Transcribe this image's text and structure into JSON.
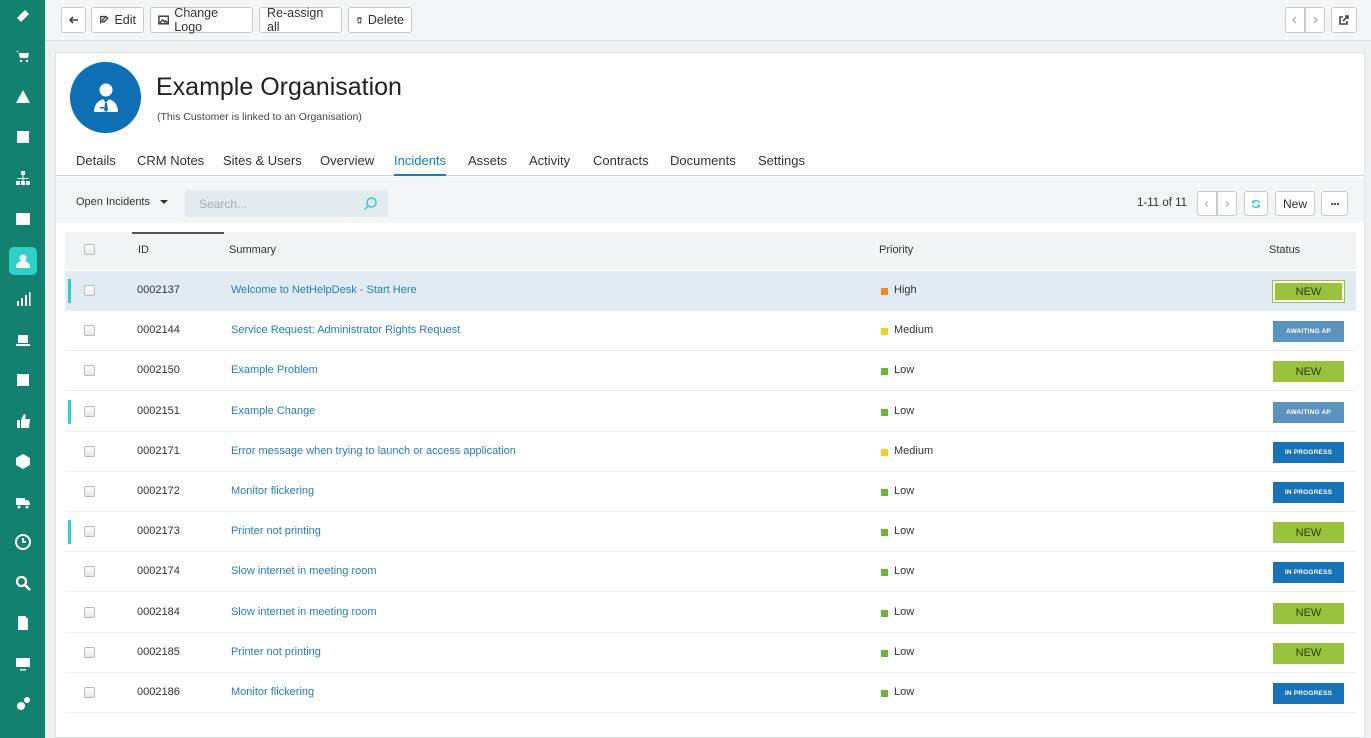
{
  "toolbar": {
    "edit_label": "Edit",
    "change_logo_label": "Change Logo",
    "reassign_label": "Re-assign all",
    "delete_label": "Delete"
  },
  "sidebar": {
    "icons": [
      "ticket-icon",
      "cart-icon",
      "warning-icon",
      "edit-icon",
      "org-chart-icon",
      "calendar-icon",
      "customer-icon",
      "analytics-icon",
      "laptop-icon",
      "notes-icon",
      "thumbs-up-icon",
      "package-icon",
      "truck-icon",
      "clock-icon",
      "search-icon",
      "document-icon",
      "monitor-icon",
      "settings-icon"
    ],
    "active_index": 6
  },
  "organisation": {
    "title": "Example Organisation",
    "subtitle": "(This Customer is linked to an Organisation)"
  },
  "tabs": [
    {
      "label": "Details"
    },
    {
      "label": "CRM Notes"
    },
    {
      "label": "Sites & Users"
    },
    {
      "label": "Overview"
    },
    {
      "label": "Incidents"
    },
    {
      "label": "Assets"
    },
    {
      "label": "Activity"
    },
    {
      "label": "Contracts"
    },
    {
      "label": "Documents"
    },
    {
      "label": "Settings"
    }
  ],
  "active_tab": "Incidents",
  "filter": {
    "selected": "Open Incidents",
    "search_placeholder": "Search...",
    "pager_text": "1-11 of 11",
    "new_label": "New"
  },
  "table": {
    "headers": {
      "id": "ID",
      "summary": "Summary",
      "priority": "Priority",
      "status": "Status"
    },
    "rows": [
      {
        "id": "0002137",
        "summary": "Welcome to NetHelpDesk - Start Here",
        "priority": "High",
        "status": "NEW"
      },
      {
        "id": "0002144",
        "summary": "Service Request: Administrator Rights Request",
        "priority": "Medium",
        "status": "AWAITING AP"
      },
      {
        "id": "0002150",
        "summary": "Example Problem",
        "priority": "Low",
        "status": "NEW"
      },
      {
        "id": "0002151",
        "summary": "Example Change",
        "priority": "Low",
        "status": "AWAITING AP"
      },
      {
        "id": "0002171",
        "summary": "Error message when trying to launch or access application",
        "priority": "Medium",
        "status": "IN PROGRESS"
      },
      {
        "id": "0002172",
        "summary": "Monitor flickering",
        "priority": "Low",
        "status": "IN PROGRESS"
      },
      {
        "id": "0002173",
        "summary": "Printer not printing",
        "priority": "Low",
        "status": "NEW"
      },
      {
        "id": "0002174",
        "summary": "Slow internet in meeting room",
        "priority": "Low",
        "status": "IN PROGRESS"
      },
      {
        "id": "0002184",
        "summary": "Slow internet in meeting room",
        "priority": "Low",
        "status": "NEW"
      },
      {
        "id": "0002185",
        "summary": "Printer not printing",
        "priority": "Low",
        "status": "NEW"
      },
      {
        "id": "0002186",
        "summary": "Monitor flickering",
        "priority": "Low",
        "status": "IN PROGRESS"
      }
    ]
  },
  "colors": {
    "sidebar": "#14806f",
    "accent": "#1a7fc1",
    "priority_high": "#f08a24",
    "priority_medium": "#f2d21f",
    "priority_low": "#6cb33e",
    "status_new": "#9ac33d",
    "status_awaiting": "#5b93c0",
    "status_in_progress": "#1872b7"
  }
}
